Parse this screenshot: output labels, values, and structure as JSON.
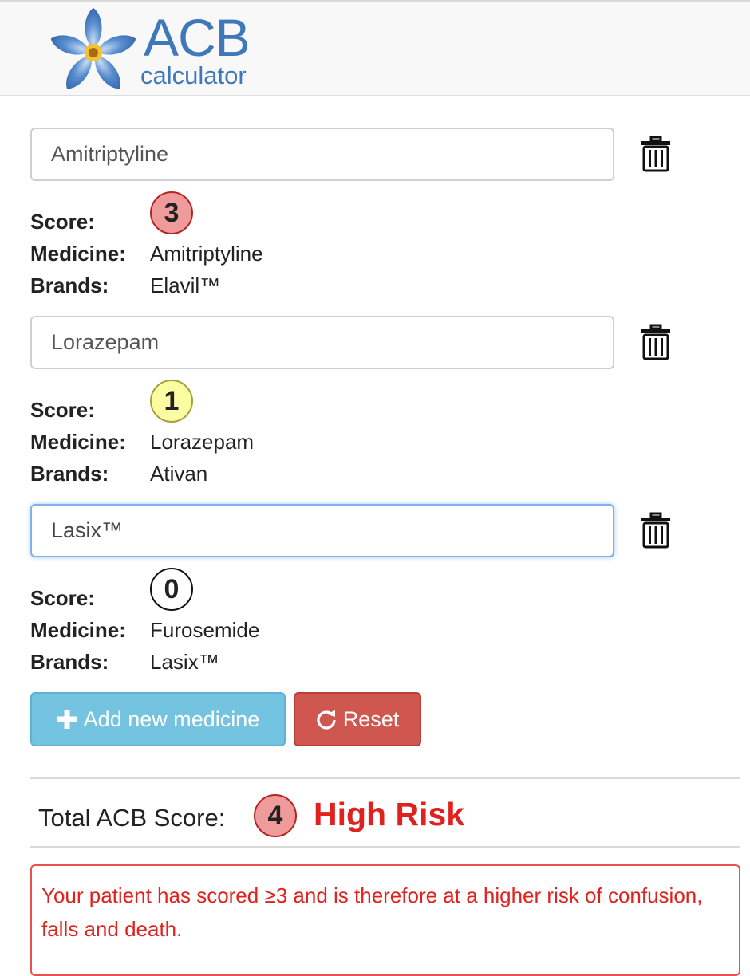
{
  "header": {
    "logo_title": "ACB",
    "logo_subtitle": "calculator"
  },
  "medicines": [
    {
      "input_value": "Amitriptyline",
      "score_label": "Score:",
      "score": "3",
      "medicine_label": "Medicine:",
      "medicine": "Amitriptyline",
      "brands_label": "Brands:",
      "brands": "Elavil™"
    },
    {
      "input_value": "Lorazepam",
      "score_label": "Score:",
      "score": "1",
      "medicine_label": "Medicine:",
      "medicine": "Lorazepam",
      "brands_label": "Brands:",
      "brands": "Ativan"
    },
    {
      "input_value": "Lasix™",
      "score_label": "Score:",
      "score": "0",
      "medicine_label": "Medicine:",
      "medicine": "Furosemide",
      "brands_label": "Brands:",
      "brands": "Lasix™"
    }
  ],
  "buttons": {
    "add_label": "Add new medicine",
    "reset_label": "Reset"
  },
  "total": {
    "label": "Total ACB Score:",
    "score": "4",
    "risk": "High Risk"
  },
  "alert": {
    "message": "Your patient has scored ≥3 and is therefore at a higher risk of confusion, falls and death."
  },
  "colors": {
    "brand_blue": "#3f78b8",
    "score_high": "#f09b9b",
    "score_low": "#fcfca2",
    "risk_red": "#e0221e",
    "add_button": "#74c3e0",
    "reset_button": "#d0574f"
  },
  "icons": {
    "trash": "trash-icon",
    "plus": "plus-icon",
    "reset": "refresh-icon",
    "logo": "flower-logo-icon"
  }
}
